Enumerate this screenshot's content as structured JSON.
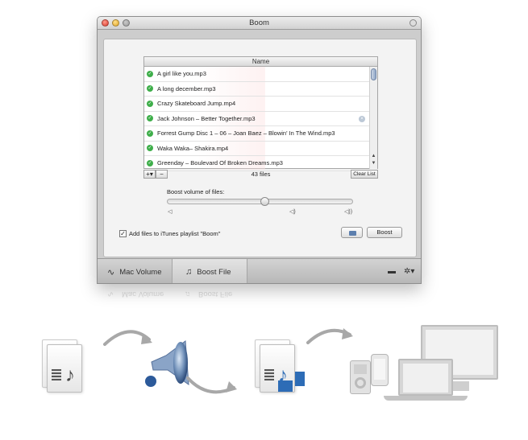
{
  "window": {
    "title": "Boom"
  },
  "file_list": {
    "header": "Name",
    "files": [
      "A girl like you.mp3",
      "A long december.mp3",
      "Crazy Skateboard Jump.mp4",
      "Jack Johnson – Better Together.mp3",
      "Forrest Gump Disc 1 – 06 – Joan Baez – Blowin' In The Wind.mp3",
      "Waka Waka– Shakira.mp4",
      "Greenday – Boulevard Of Broken Dreams.mp3"
    ],
    "count_label": "43 files",
    "add_label": "+▾",
    "remove_label": "−",
    "clear_label": "Clear List"
  },
  "boost": {
    "label": "Boost volume of files:",
    "level": 0.53
  },
  "options": {
    "itunes_label": "Add files to iTunes playlist \"Boom\"",
    "itunes_checked": true,
    "boost_button": "Boost"
  },
  "tabs": {
    "mac_volume": "Mac Volume",
    "boost_file": "Boost File"
  },
  "icons": {
    "status": "check-circle-icon",
    "folder": "folder-icon",
    "settings": "gear-icon",
    "chat": "speech-bubble-icon"
  },
  "colors": {
    "check_green": "#3eae4a",
    "accent_blue": "#2d6cb6"
  }
}
